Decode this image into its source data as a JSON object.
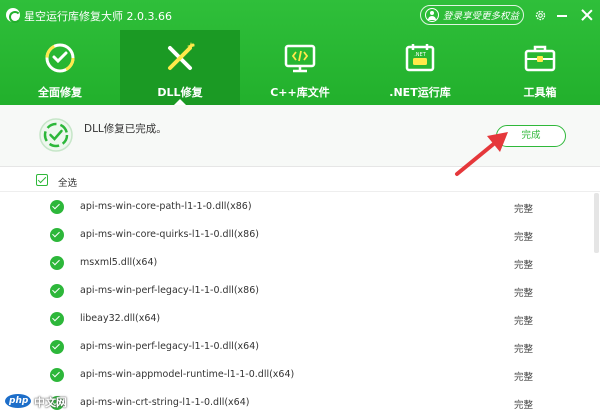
{
  "window": {
    "title": "星空运行库修复大师 2.0.3.66",
    "login_label": "登录享受更多权益"
  },
  "tabs": [
    {
      "label": "全面修复",
      "icon": "refresh-shield-icon"
    },
    {
      "label": "DLL修复",
      "icon": "wrench-screwdriver-icon"
    },
    {
      "label": "C++库文件",
      "icon": "code-monitor-icon"
    },
    {
      "label": ".NET运行库",
      "icon": "dotnet-calendar-icon"
    },
    {
      "label": "工具箱",
      "icon": "toolbox-icon"
    }
  ],
  "active_tab": "DLL修复",
  "status": {
    "message": "DLL修复已完成。",
    "done_label": "完成"
  },
  "list": {
    "select_all_label": "全选",
    "items": [
      {
        "name": "api-ms-win-core-path-l1-1-0.dll(x86)",
        "status": "完整"
      },
      {
        "name": "api-ms-win-core-quirks-l1-1-0.dll(x86)",
        "status": "完整"
      },
      {
        "name": "msxml5.dll(x64)",
        "status": "完整"
      },
      {
        "name": "api-ms-win-perf-legacy-l1-1-0.dll(x86)",
        "status": "完整"
      },
      {
        "name": "libeay32.dll(x64)",
        "status": "完整"
      },
      {
        "name": "api-ms-win-perf-legacy-l1-1-0.dll(x64)",
        "status": "完整"
      },
      {
        "name": "api-ms-win-appmodel-runtime-l1-1-0.dll(x64)",
        "status": "完整"
      },
      {
        "name": "api-ms-win-crt-string-l1-1-0.dll(x64)",
        "status": "完整"
      }
    ]
  },
  "watermark": {
    "badge": "php",
    "text": "中文网"
  },
  "colors": {
    "brand_green": "#22b02c",
    "active_tab": "#1b9a24",
    "check_green": "#2db73a",
    "arrow_red": "#e5383b"
  }
}
